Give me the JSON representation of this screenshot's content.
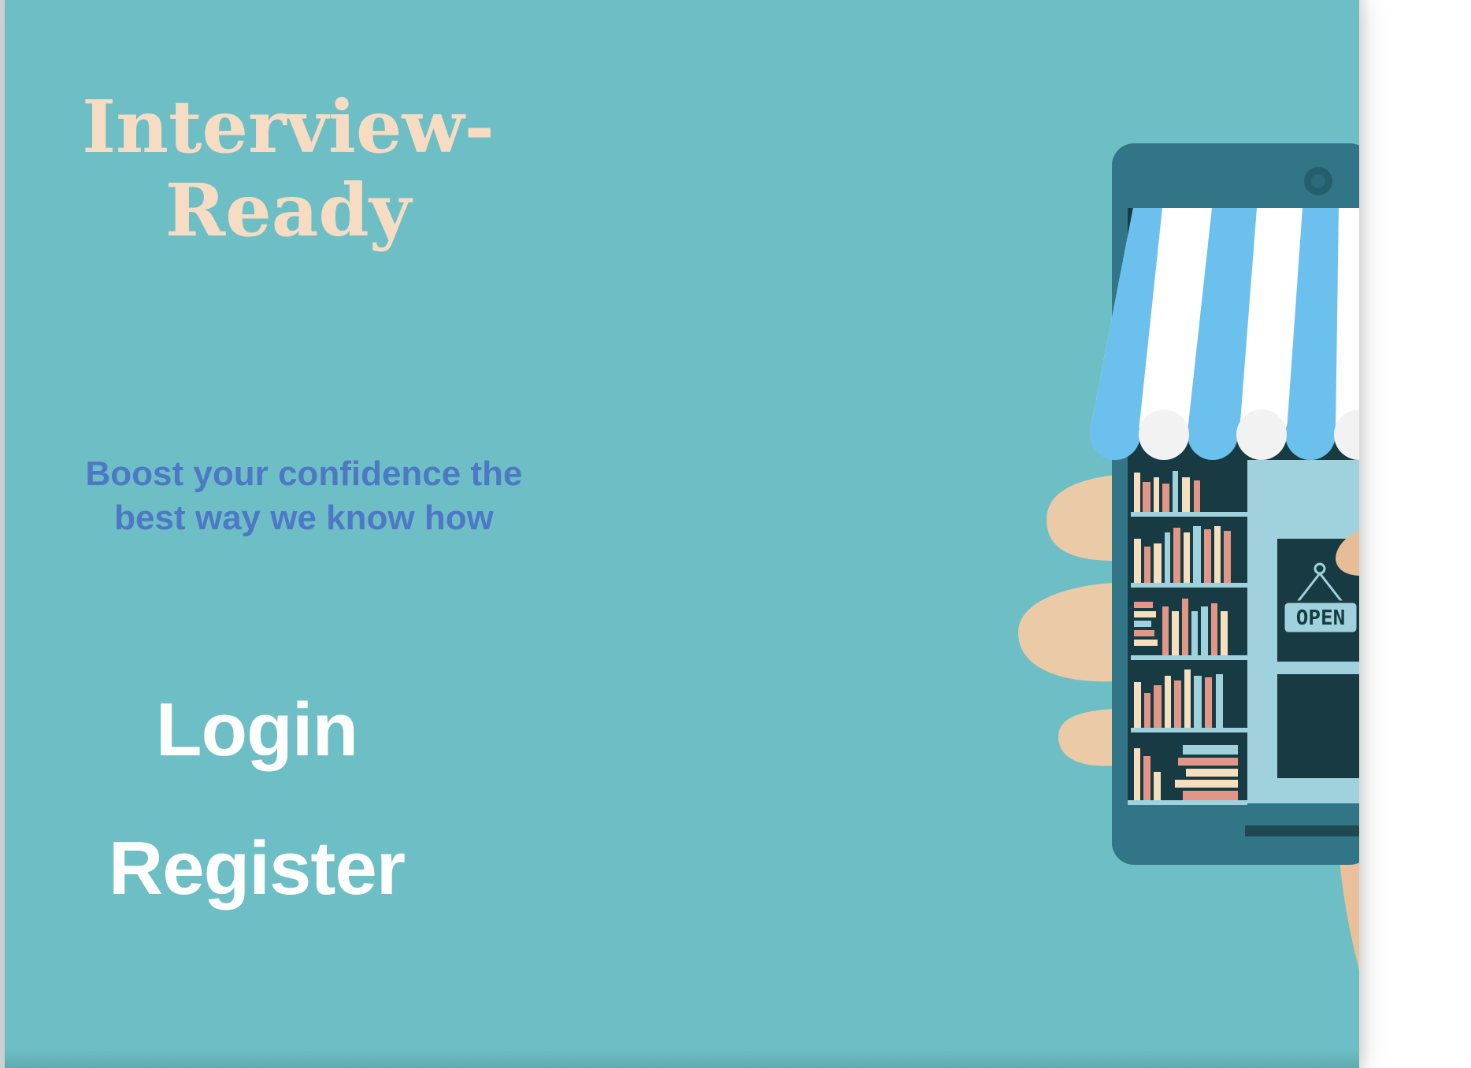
{
  "hero": {
    "title": "Interview-\nReady",
    "tagline": "Boost your confidence the best way we know how"
  },
  "nav": {
    "login_label": "Login",
    "register_label": "Register"
  },
  "illustration": {
    "sign_text": "OPEN"
  },
  "colors": {
    "background": "#6dbfc5",
    "title": "#f7dcc4",
    "tagline": "#4d78c6",
    "links": "#ffffff"
  }
}
